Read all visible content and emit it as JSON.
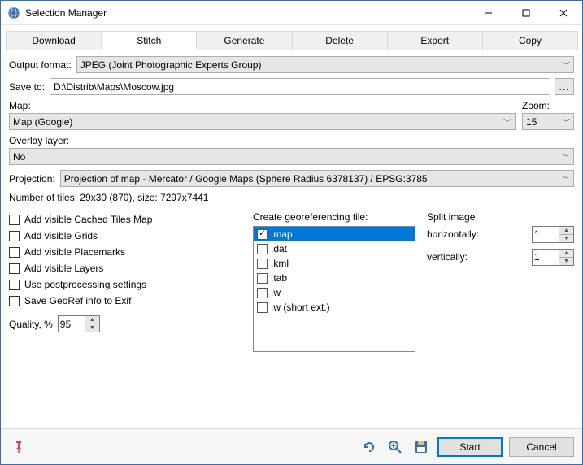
{
  "window": {
    "title": "Selection Manager",
    "minimize_label": "Minimize",
    "maximize_label": "Maximize",
    "close_label": "Close"
  },
  "tabs": {
    "download": "Download",
    "stitch": "Stitch",
    "generate": "Generate",
    "delete": "Delete",
    "export": "Export",
    "copy": "Copy"
  },
  "labels": {
    "output_format": "Output format:",
    "save_to": "Save to:",
    "map": "Map:",
    "zoom": "Zoom:",
    "overlay": "Overlay layer:",
    "projection": "Projection:",
    "georef": "Create georeferencing file:",
    "split": "Split image",
    "horiz": "horizontally:",
    "vert": "vertically:",
    "quality": "Quality, %"
  },
  "values": {
    "output_format": "JPEG (Joint Photographic Experts Group)",
    "save_to": "D:\\Distrib\\Maps\\Moscow.jpg",
    "map": "Map (Google)",
    "zoom": "15",
    "overlay": "No",
    "projection": "Projection of map - Mercator / Google Maps (Sphere Radius 6378137) / EPSG:3785",
    "split_h": "1",
    "split_v": "1",
    "quality": "95"
  },
  "info": "Number of tiles: 29x30 (870), size: 7297x7441",
  "checks": {
    "cached": "Add visible Cached Tiles Map",
    "grids": "Add visible Grids",
    "placemarks": "Add visible Placemarks",
    "layers": "Add visible Layers",
    "postproc": "Use postprocessing settings",
    "georef_exif": "Save GeoRef info to Exif"
  },
  "georef_items": {
    "map": ".map",
    "dat": ".dat",
    "kml": ".kml",
    "tab": ".tab",
    "w": ".w",
    "wshort": ".w (short ext.)"
  },
  "footer": {
    "start": "Start",
    "cancel": "Cancel"
  },
  "browse_btn": "..."
}
